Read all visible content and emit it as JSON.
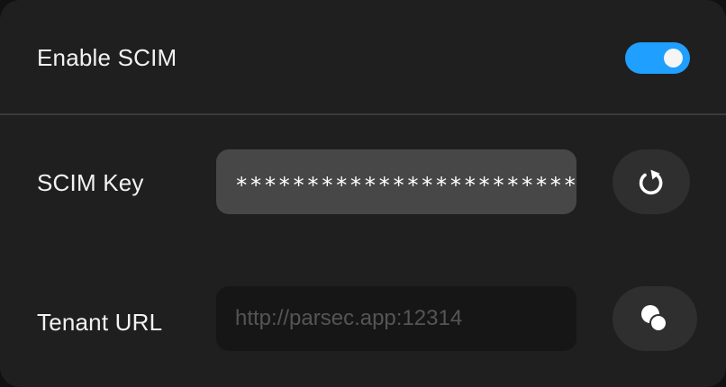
{
  "settings": {
    "enable_scim": {
      "label": "Enable SCIM",
      "enabled": true,
      "accent_color": "#1f9fff"
    },
    "scim_key": {
      "label": "SCIM Key",
      "value": "************************",
      "action_icon": "refresh-icon"
    },
    "tenant_url": {
      "label": "Tenant URL",
      "placeholder": "http://parsec.app:12314",
      "action_icon": "copy-icon"
    }
  }
}
